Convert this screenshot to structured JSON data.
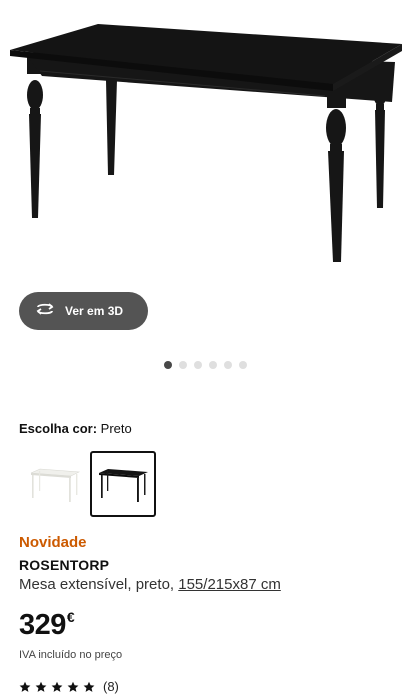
{
  "product": {
    "view_3d_label": "Ver em 3D",
    "image_count": 6,
    "active_image_index": 0,
    "color_label": "Escolha cor:",
    "color_value": "Preto",
    "color_options": [
      "branco",
      "preto"
    ],
    "selected_color_index": 1,
    "badge": "Novidade",
    "name": "ROSENTORP",
    "description": "Mesa extensível, preto,",
    "dimensions": "155/215x87 cm",
    "price_value": "329",
    "currency": "€",
    "vat_note": "IVA incluído no preço",
    "rating_stars": 5,
    "rating_count": "(8)"
  },
  "colors": {
    "badge": "#cc5a00",
    "button_bg": "#545454",
    "table": "#141414"
  }
}
